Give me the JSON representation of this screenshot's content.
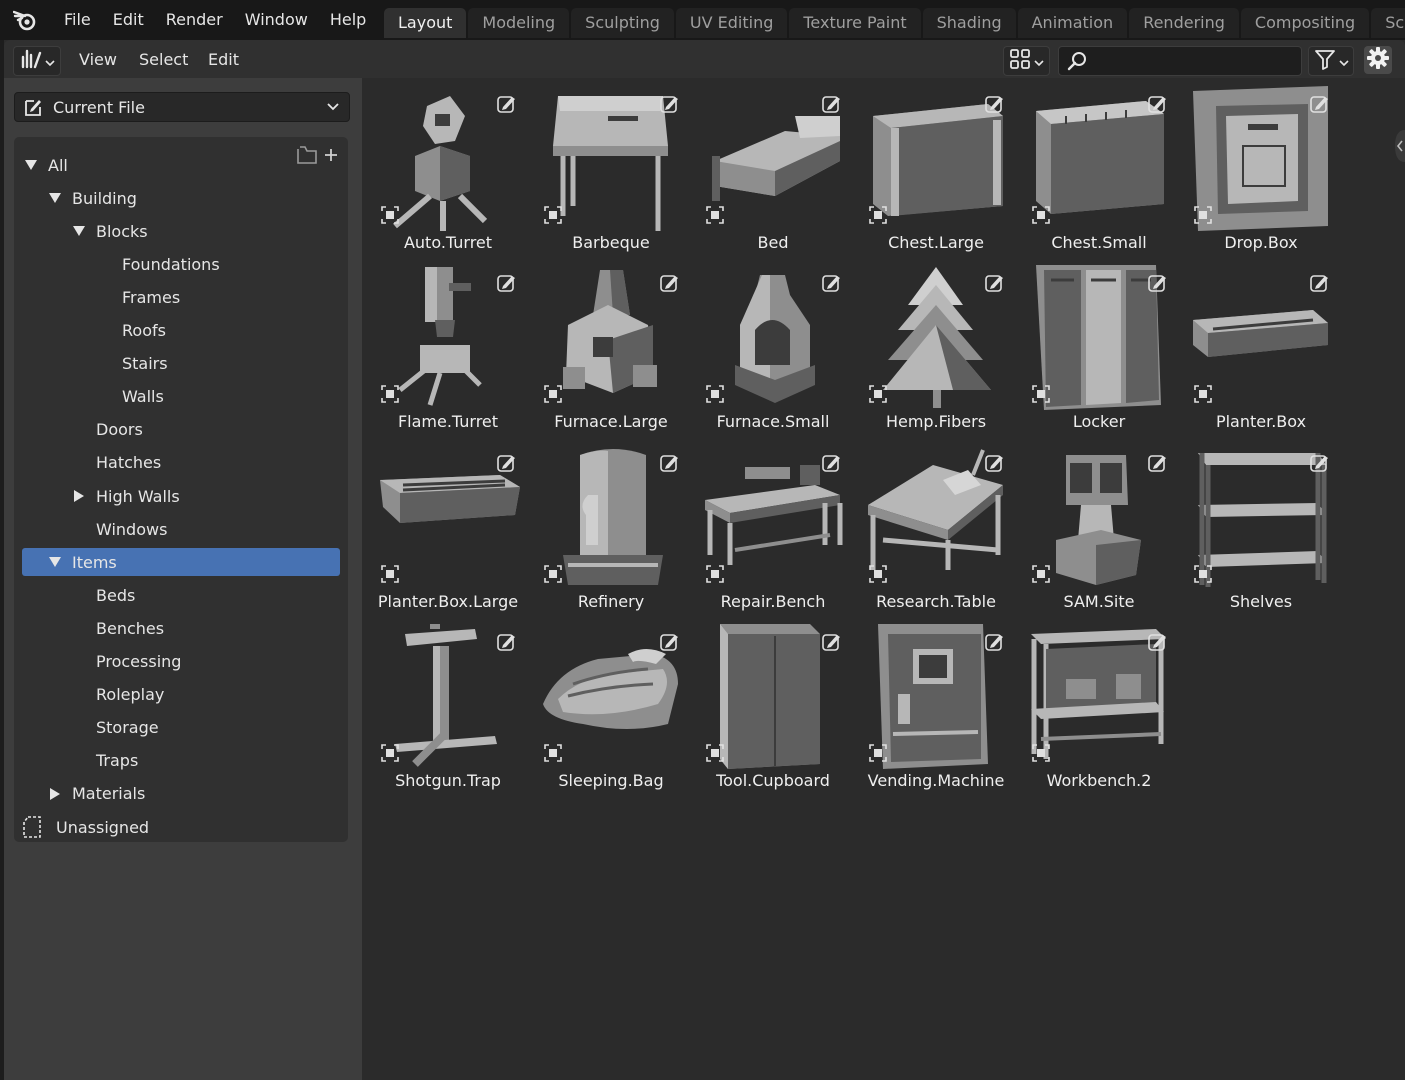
{
  "topbar": {
    "menus": [
      "File",
      "Edit",
      "Render",
      "Window",
      "Help"
    ],
    "workspaces": [
      {
        "label": "Layout",
        "active": true
      },
      {
        "label": "Modeling",
        "active": false
      },
      {
        "label": "Sculpting",
        "active": false
      },
      {
        "label": "UV Editing",
        "active": false
      },
      {
        "label": "Texture Paint",
        "active": false
      },
      {
        "label": "Shading",
        "active": false
      },
      {
        "label": "Animation",
        "active": false
      },
      {
        "label": "Rendering",
        "active": false
      },
      {
        "label": "Compositing",
        "active": false
      },
      {
        "label": "Scripting",
        "active": false
      }
    ]
  },
  "header": {
    "menus": [
      "View",
      "Select",
      "Edit"
    ],
    "search": {
      "value": "",
      "placeholder": ""
    },
    "icons": {
      "editor_type": "asset-browser-icon",
      "display": "grid-view-icon",
      "filter": "filter-icon",
      "settings": "gear-icon"
    }
  },
  "sidebar": {
    "library": "Current File",
    "catalogs": [
      {
        "label": "All",
        "depth": 0,
        "expander": "open"
      },
      {
        "label": "Building",
        "depth": 1,
        "expander": "open"
      },
      {
        "label": "Blocks",
        "depth": 2,
        "expander": "open"
      },
      {
        "label": "Foundations",
        "depth": 3,
        "expander": "none"
      },
      {
        "label": "Frames",
        "depth": 3,
        "expander": "none"
      },
      {
        "label": "Roofs",
        "depth": 3,
        "expander": "none"
      },
      {
        "label": "Stairs",
        "depth": 3,
        "expander": "none"
      },
      {
        "label": "Walls",
        "depth": 3,
        "expander": "none"
      },
      {
        "label": "Doors",
        "depth": 2,
        "expander": "none"
      },
      {
        "label": "Hatches",
        "depth": 2,
        "expander": "none"
      },
      {
        "label": "High Walls",
        "depth": 2,
        "expander": "closed"
      },
      {
        "label": "Windows",
        "depth": 2,
        "expander": "none"
      },
      {
        "label": "Items",
        "depth": 1,
        "expander": "open",
        "active": true
      },
      {
        "label": "Beds",
        "depth": 2,
        "expander": "none"
      },
      {
        "label": "Benches",
        "depth": 2,
        "expander": "none"
      },
      {
        "label": "Processing",
        "depth": 2,
        "expander": "none"
      },
      {
        "label": "Roleplay",
        "depth": 2,
        "expander": "none"
      },
      {
        "label": "Storage",
        "depth": 2,
        "expander": "none"
      },
      {
        "label": "Traps",
        "depth": 2,
        "expander": "none"
      },
      {
        "label": "Materials",
        "depth": 1,
        "expander": "closed"
      },
      {
        "label": "Unassigned",
        "depth": 0,
        "expander": "unassigned"
      }
    ]
  },
  "assets": [
    {
      "name": "Auto.Turret",
      "shape": "turret"
    },
    {
      "name": "Barbeque",
      "shape": "barbeque"
    },
    {
      "name": "Bed",
      "shape": "bed"
    },
    {
      "name": "Chest.Large",
      "shape": "chest-large"
    },
    {
      "name": "Chest.Small",
      "shape": "chest-small"
    },
    {
      "name": "Drop.Box",
      "shape": "dropbox"
    },
    {
      "name": "Flame.Turret",
      "shape": "flame-turret"
    },
    {
      "name": "Furnace.Large",
      "shape": "furnace-large"
    },
    {
      "name": "Furnace.Small",
      "shape": "furnace-small"
    },
    {
      "name": "Hemp.Fibers",
      "shape": "tree"
    },
    {
      "name": "Locker",
      "shape": "locker"
    },
    {
      "name": "Planter.Box",
      "shape": "planter"
    },
    {
      "name": "Planter.Box.Large",
      "shape": "planter-large"
    },
    {
      "name": "Refinery",
      "shape": "refinery"
    },
    {
      "name": "Repair.Bench",
      "shape": "repair-bench"
    },
    {
      "name": "Research.Table",
      "shape": "research-table"
    },
    {
      "name": "SAM.Site",
      "shape": "sam-site"
    },
    {
      "name": "Shelves",
      "shape": "shelves"
    },
    {
      "name": "Shotgun.Trap",
      "shape": "shotgun-trap"
    },
    {
      "name": "Sleeping.Bag",
      "shape": "sleeping-bag"
    },
    {
      "name": "Tool.Cupboard",
      "shape": "cupboard"
    },
    {
      "name": "Vending.Machine",
      "shape": "vending"
    },
    {
      "name": "Workbench.2",
      "shape": "workbench"
    }
  ],
  "colors": {
    "active_row": "#4772b3",
    "mesh_light": "#b4b4b4",
    "mesh_mid": "#8c8c8c",
    "mesh_dark": "#5e5e5e"
  }
}
